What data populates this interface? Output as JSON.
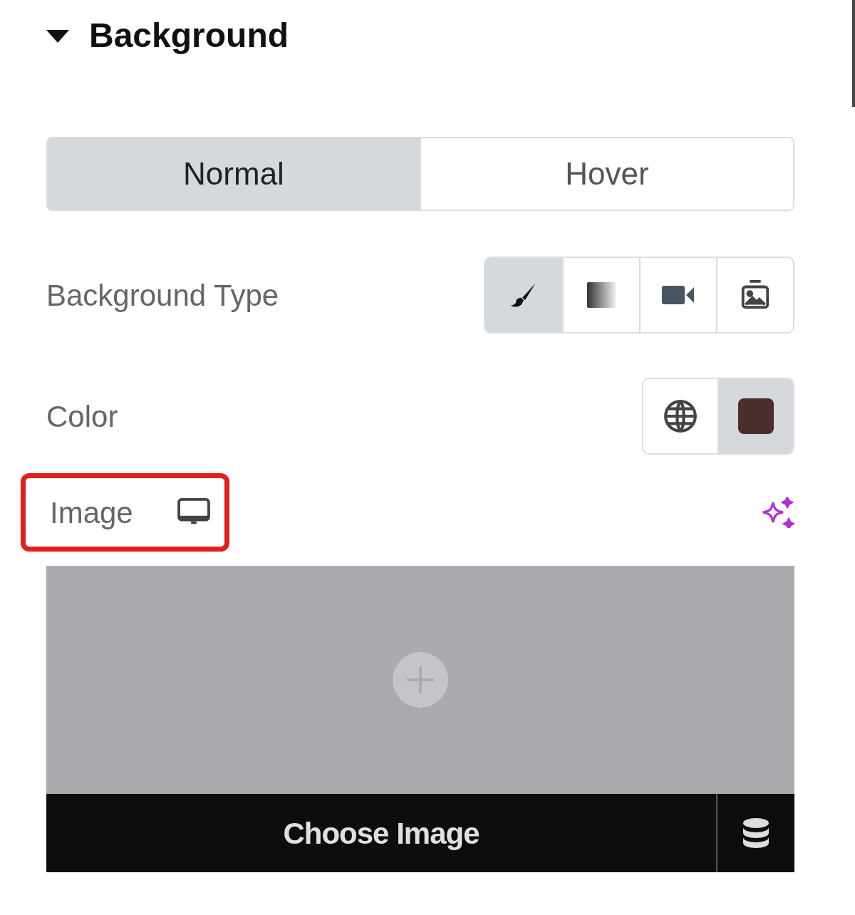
{
  "section": {
    "title": "Background",
    "expanded": true
  },
  "tabs": [
    {
      "label": "Normal",
      "selected": true
    },
    {
      "label": "Hover",
      "selected": false
    }
  ],
  "background_type": {
    "label": "Background Type",
    "options": [
      {
        "kind": "brush",
        "selected": true
      },
      {
        "kind": "gradient",
        "selected": false
      },
      {
        "kind": "video",
        "selected": false
      },
      {
        "kind": "slideshow",
        "selected": false
      }
    ]
  },
  "color": {
    "label": "Color",
    "color": "#4b2e2e"
  },
  "image": {
    "label": "Image",
    "highlighted": true,
    "button": "Choose Image"
  }
}
